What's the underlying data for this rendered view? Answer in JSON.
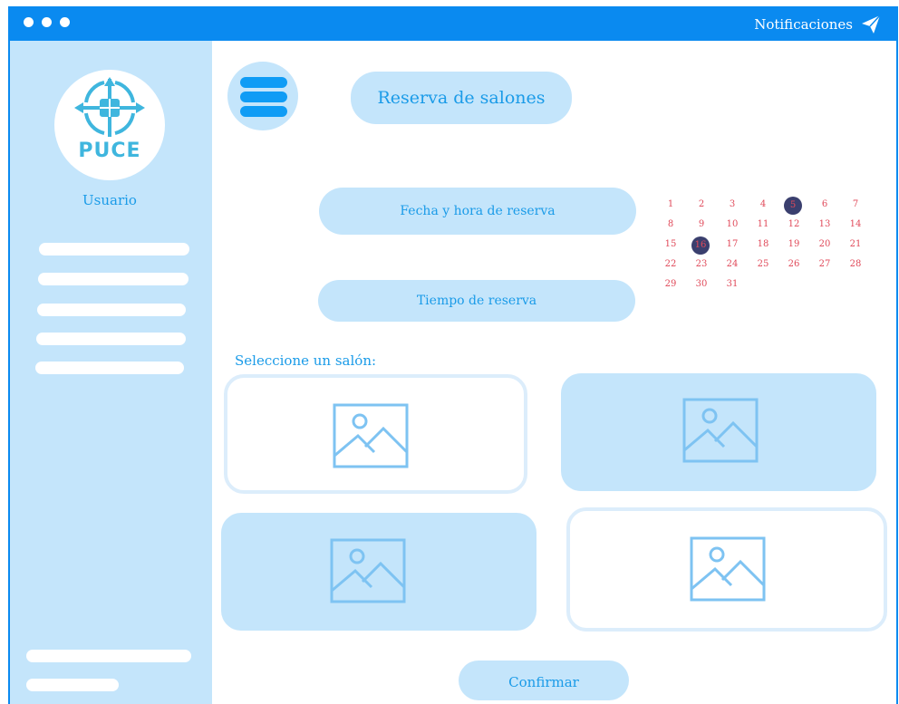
{
  "topbar": {
    "notifications_label": "Notificaciones",
    "icon": "paper-plane-icon"
  },
  "sidebar": {
    "logo_text": "PUCE",
    "user_label": "Usuario"
  },
  "header": {
    "title": "Reserva de salones"
  },
  "form": {
    "date_time_label": "Fecha y hora  de reserva",
    "duration_label": "Tiempo de reserva"
  },
  "calendar": {
    "days": [
      "1",
      "2",
      "3",
      "4",
      "5",
      "6",
      "7",
      "8",
      "9",
      "10",
      "11",
      "12",
      "13",
      "14",
      "15",
      "16",
      "17",
      "18",
      "19",
      "20",
      "21",
      "22",
      "23",
      "24",
      "25",
      "26",
      "27",
      "28",
      "29",
      "30",
      "31"
    ],
    "highlighted": [
      "5",
      "16"
    ]
  },
  "rooms": {
    "section_label": "Seleccione un salón:"
  },
  "actions": {
    "confirm_label": "Confirmar"
  },
  "colors": {
    "accent": "#0a8af0",
    "panel": "#c4e5fb",
    "calendar_text": "#e04a5a",
    "calendar_highlight": "#3a3f6e"
  }
}
